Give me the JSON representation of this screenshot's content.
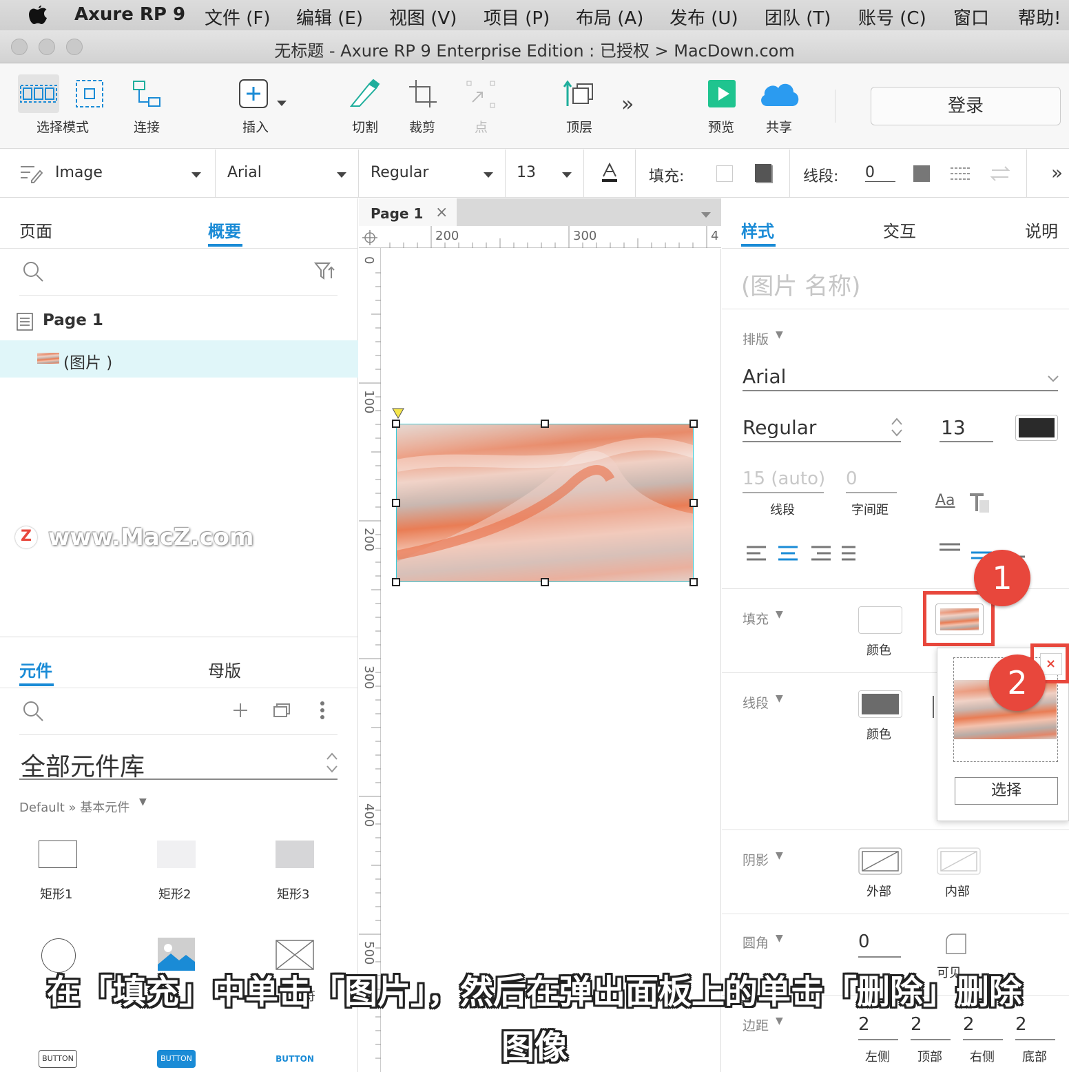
{
  "menubar": {
    "app": "Axure RP 9",
    "items": [
      "文件 (F)",
      "编辑 (E)",
      "视图 (V)",
      "项目 (P)",
      "布局 (A)",
      "发布 (U)",
      "团队 (T)",
      "账号 (C)",
      "窗口",
      "帮助!"
    ]
  },
  "window": {
    "title": "无标题 - Axure RP 9 Enterprise Edition : 已授权 > MacDown.com"
  },
  "toolbar": {
    "select_mode": "选择模式",
    "connect": "连接",
    "insert": "插入",
    "slice": "切割",
    "crop": "裁剪",
    "point": "点",
    "top": "顶层",
    "more": "»",
    "preview": "预览",
    "share": "共享",
    "login": "登录"
  },
  "format": {
    "style": "Image",
    "font": "Arial",
    "weight": "Regular",
    "size": "13",
    "fill_label": "填充:",
    "stroke_label": "线段:",
    "stroke_value": "0"
  },
  "left_top": {
    "tab_pages": "页面",
    "tab_outline": "概要",
    "page_name": "Page 1",
    "image_item": "(图片 )"
  },
  "watermark": "www.MacZ.com",
  "left_bottom": {
    "tab_widgets": "元件",
    "tab_masters": "母版",
    "library": "全部元件库",
    "breadcrumb": "Default » 基本元件",
    "widgets": [
      {
        "label": "矩形1"
      },
      {
        "label": "矩形2"
      },
      {
        "label": "矩形3"
      }
    ],
    "button_labels": [
      "BUTTON",
      "BUTTON",
      "BUTTON"
    ],
    "partial_label": "符"
  },
  "canvas": {
    "tab": "Page 1",
    "ruler_h": [
      "200",
      "300",
      "4"
    ],
    "ruler_v": [
      "0",
      "100",
      "200",
      "300",
      "400",
      "500"
    ]
  },
  "right": {
    "tab_style": "样式",
    "tab_interact": "交互",
    "tab_notes": "说明",
    "name_placeholder": "(图片 名称)",
    "typography_label": "排版",
    "font": "Arial",
    "weight": "Regular",
    "size": "13",
    "line_height": "15 (auto)",
    "line_label": "线段",
    "char_spacing": "0",
    "char_spacing_label": "字间距",
    "aa_icon": "Aa",
    "fill_label": "填充",
    "fill_color": "颜色",
    "stroke_label": "线段",
    "stroke_color": "颜色",
    "popup_select": "选择",
    "shadow_label": "阴影",
    "shadow_outer": "外部",
    "shadow_inner": "内部",
    "radius_label": "圆角",
    "radius_value": "0",
    "visible_label": "可见",
    "padding_label": "边距",
    "padding": [
      {
        "v": "2",
        "l": "左侧"
      },
      {
        "v": "2",
        "l": "顶部"
      },
      {
        "v": "2",
        "l": "右侧"
      },
      {
        "v": "2",
        "l": "底部"
      }
    ]
  },
  "callouts": [
    "1",
    "2"
  ],
  "caption": {
    "line1": "在「填充」中单击「图片」，然后在弹出面板上的单击「删除」删除",
    "line2": "图像"
  },
  "colors": {
    "accent": "#1a8bd6",
    "callout": "#e8473c",
    "selection": "#3ccbd8",
    "canvas_bg": "#ffffff",
    "panel_bg": "#f7f7f7"
  }
}
